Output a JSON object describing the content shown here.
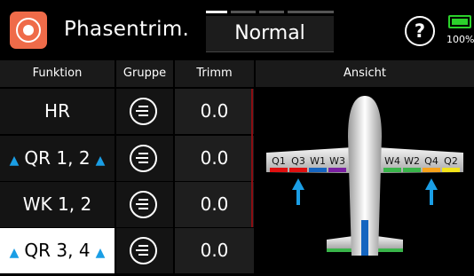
{
  "header": {
    "title": "Phasentrim.",
    "mode_label": "Normal",
    "help_label": "?",
    "battery_percent": "100%"
  },
  "table": {
    "columns": [
      "Funktion",
      "Gruppe",
      "Trimm",
      "Ansicht"
    ],
    "rows": [
      {
        "function": "HR",
        "trim": "0.0",
        "arrows": false,
        "selected": false
      },
      {
        "function": "QR 1, 2",
        "trim": "0.0",
        "arrows": true,
        "selected": false
      },
      {
        "function": "WK 1, 2",
        "trim": "0.0",
        "arrows": false,
        "selected": false
      },
      {
        "function": "QR 3, 4",
        "trim": "0.0",
        "arrows": true,
        "selected": true
      }
    ]
  },
  "plane": {
    "left_labels": [
      "Q1",
      "Q3",
      "W1",
      "W3"
    ],
    "right_labels": [
      "W4",
      "W2",
      "Q4",
      "Q2"
    ],
    "left_colors": [
      "#e01010",
      "#e01010",
      "#1565c0",
      "#7b1fa2"
    ],
    "right_colors": [
      "#39b54a",
      "#39b54a",
      "#f7a21b",
      "#f2e31a"
    ],
    "arrow_color": "#1a9ee5"
  },
  "colors": {
    "accent": "#ef6b49",
    "battery": "#2bd12b",
    "arrow": "#1a9ee5"
  }
}
